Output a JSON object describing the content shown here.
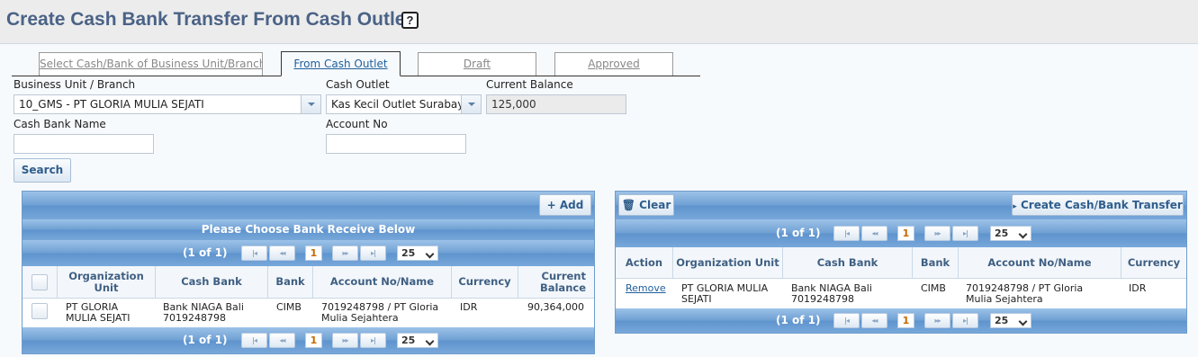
{
  "page": {
    "title": "Create Cash Bank Transfer From Cash Outlet",
    "help_icon": "?"
  },
  "tabs": [
    {
      "label": "Select Cash/Bank of Business Unit/Branch",
      "active": false
    },
    {
      "label": "From Cash Outlet",
      "active": true
    },
    {
      "label": "Draft",
      "active": false
    },
    {
      "label": "Approved",
      "active": false
    }
  ],
  "form": {
    "business_unit_label": "Business Unit / Branch",
    "business_unit_value": "10_GMS - PT GLORIA MULIA SEJATI",
    "cash_outlet_label": "Cash Outlet",
    "cash_outlet_value": "Kas Kecil Outlet Surabaya",
    "current_balance_label": "Current Balance",
    "current_balance_value": "125,000",
    "cash_bank_name_label": "Cash Bank Name",
    "cash_bank_name_value": "",
    "account_no_label": "Account No",
    "account_no_value": "",
    "search_label": "Search"
  },
  "left_panel": {
    "add_label": "+ Add",
    "caption": "Please Choose Bank Receive Below",
    "pager": {
      "info": "(1 of 1)",
      "first": "|◂",
      "prev": "◂◂",
      "page": "1",
      "next": "▸▸",
      "last": "▸|",
      "size": "25"
    },
    "columns": [
      "",
      "Organization Unit",
      "Cash Bank",
      "Bank",
      "Account No/Name",
      "Currency",
      "Current Balance"
    ],
    "rows": [
      {
        "org": "PT GLORIA MULIA SEJATI",
        "cash_bank": "Bank NIAGA Bali 7019248798",
        "bank": "CIMB",
        "account": "7019248798 / PT Gloria Mulia Sejahtera",
        "currency": "IDR",
        "balance": "90,364,000"
      }
    ]
  },
  "right_panel": {
    "clear_label": "Clear",
    "create_label": "Create Cash/Bank Transfer",
    "pager": {
      "info": "(1 of 1)",
      "first": "|◂",
      "prev": "◂◂",
      "page": "1",
      "next": "▸▸",
      "last": "▸|",
      "size": "25"
    },
    "columns": [
      "Action",
      "Organization Unit",
      "Cash Bank",
      "Bank",
      "Account No/Name",
      "Currency"
    ],
    "rows": [
      {
        "action": "Remove",
        "org": "PT GLORIA MULIA SEJATI",
        "cash_bank": "Bank NIAGA Bali 7019248798",
        "bank": "CIMB",
        "account": "7019248798 / PT Gloria Mulia Sejahtera",
        "currency": "IDR"
      }
    ]
  },
  "colors": {
    "header_title": "#4a6286",
    "bar_blue": "#6e9fd3",
    "link": "#1e5f9c"
  }
}
